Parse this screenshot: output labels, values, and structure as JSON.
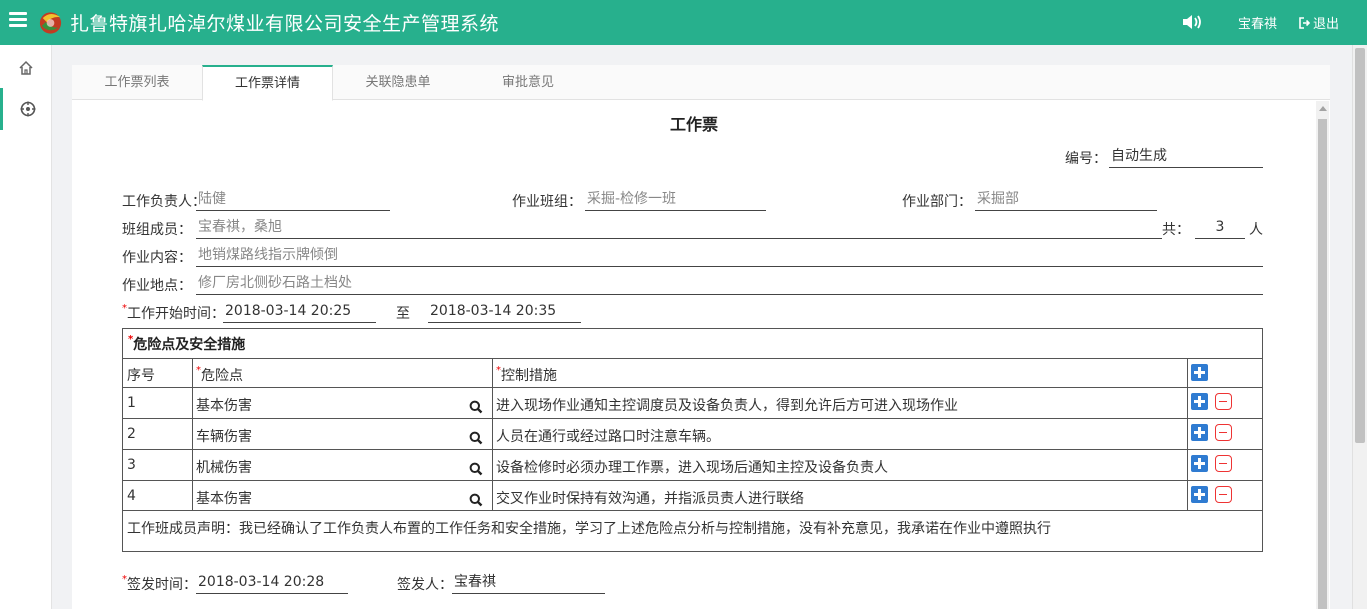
{
  "header": {
    "title": "扎鲁特旗扎哈淖尔煤业有限公司安全生产管理系统",
    "user": "宝春祺",
    "logout": "退出",
    "color": "#27b08d"
  },
  "sidebar": {
    "items": [
      {
        "icon": "home-icon"
      },
      {
        "icon": "target-icon"
      }
    ]
  },
  "tabs": [
    "工作票列表",
    "工作票详情",
    "关联隐患单",
    "审批意见"
  ],
  "active_tab": "工作票详情",
  "form": {
    "title": "工作票",
    "number_label": "编号：",
    "number_value": "自动生成",
    "leader_label": "工作负责人：",
    "leader_value": "陆健",
    "team_label": "作业班组：",
    "team_value": "采掘-检修一班",
    "dept_label": "作业部门：",
    "dept_value": "采掘部",
    "members_label": "班组成员：",
    "members_value": "宝春祺，桑旭",
    "total_label": "共：",
    "total_value": "3",
    "total_unit": "人",
    "content_label": "作业内容：",
    "content_value": "地销煤路线指示牌倾倒",
    "location_label": "作业地点：",
    "location_value": "修厂房北侧砂石路土档处",
    "start_label": "工作开始时间：",
    "start_value": "2018-03-14 20:25",
    "to_label": "至",
    "end_value": "2018-03-14 20:35",
    "issue_time_label": "签发时间：",
    "issue_time_value": "2018-03-14 20:28",
    "issuer_label": "签发人：",
    "issuer_value": "宝春祺"
  },
  "hazards": {
    "title": "危险点及安全措施",
    "columns": [
      "序号",
      "危险点",
      "控制措施"
    ],
    "rows": [
      {
        "no": "1",
        "hazard": "基本伤害",
        "measure": "进入现场作业通知主控调度员及设备负责人，得到允许后方可进入现场作业"
      },
      {
        "no": "2",
        "hazard": "车辆伤害",
        "measure": "人员在通行或经过路口时注意车辆。"
      },
      {
        "no": "3",
        "hazard": "机械伤害",
        "measure": "设备检修时必须办理工作票，进入现场后通知主控及设备负责人"
      },
      {
        "no": "4",
        "hazard": "基本伤害",
        "measure": "交叉作业时保持有效沟通，并指派员责人进行联络"
      }
    ],
    "statement": "工作班成员声明：我已经确认了工作负责人布置的工作任务和安全措施，学习了上述危险点分析与控制措施，没有补充意见，我承诺在作业中遵照执行"
  }
}
